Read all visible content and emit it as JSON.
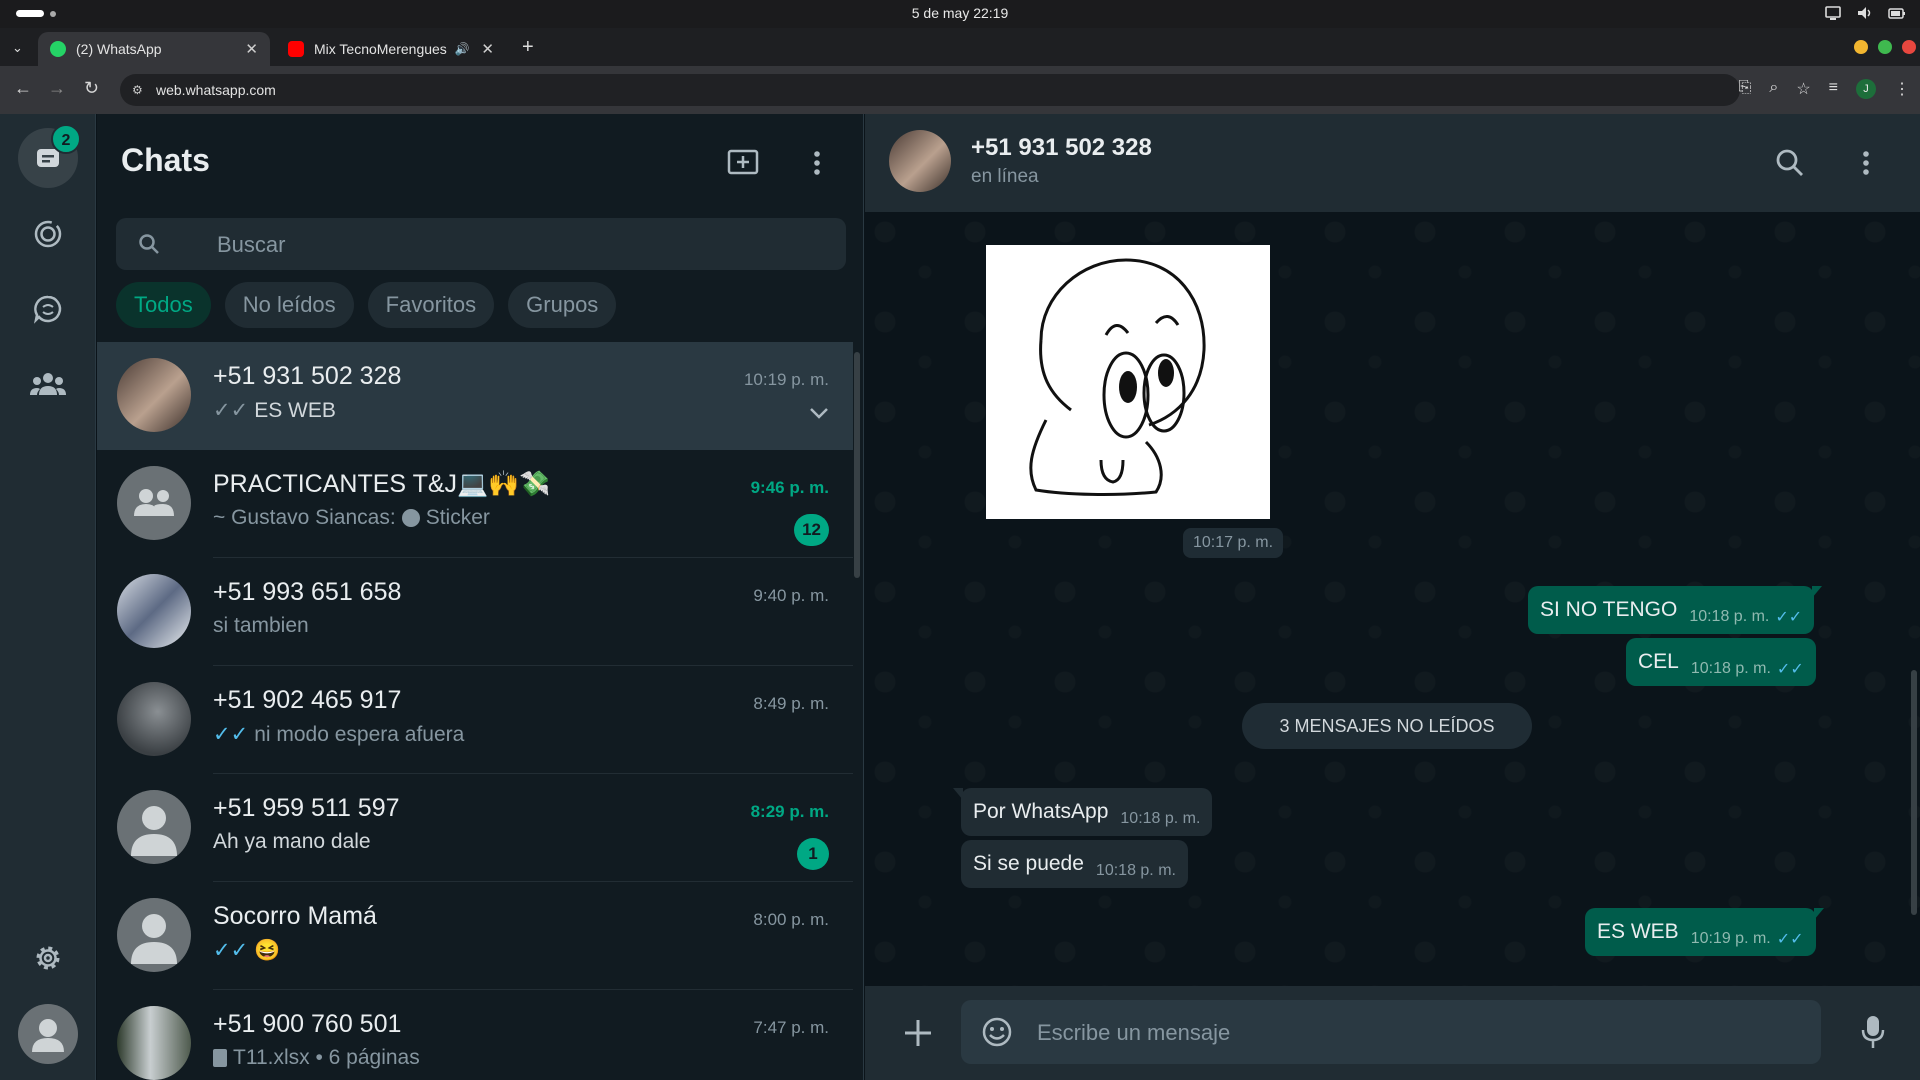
{
  "os": {
    "clock": "5 de may  22:19"
  },
  "browser": {
    "tabs": [
      {
        "label": "(2) WhatsApp",
        "active": true
      },
      {
        "label": "Mix TecnoMerengues",
        "active": false
      }
    ],
    "url": "web.whatsapp.com",
    "profile_initial": "J"
  },
  "rail": {
    "chats_badge": "2"
  },
  "list": {
    "title": "Chats",
    "search_placeholder": "Buscar",
    "filters": [
      "Todos",
      "No leídos",
      "Favoritos",
      "Grupos"
    ],
    "chats": [
      {
        "name": "+51 931 502 328",
        "preview": "ES WEB",
        "time": "10:19 p. m.",
        "ticks": "grey",
        "selected": true
      },
      {
        "name": "PRACTICANTES T&J💻🙌💸",
        "preview": "~ Gustavo Siancas: ",
        "preview_extra": "Sticker",
        "time": "9:46 p. m.",
        "unread": "12"
      },
      {
        "name": "+51 993 651 658",
        "preview": "si tambien",
        "time": "9:40 p. m."
      },
      {
        "name": "+51 902 465 917",
        "preview": "ni modo espera afuera",
        "time": "8:49 p. m.",
        "ticks": "blue"
      },
      {
        "name": "+51 959 511 597",
        "preview": "Ah ya mano dale",
        "time": "8:29 p. m.",
        "unread": "1"
      },
      {
        "name": "Socorro Mamá",
        "preview": "😆",
        "time": "8:00 p. m.",
        "ticks": "blue"
      },
      {
        "name": "+51 900 760 501",
        "preview": "T11.xlsx • 6 páginas",
        "time": "7:47 p. m."
      }
    ]
  },
  "conversation": {
    "name": "+51 931 502 328",
    "status": "en línea",
    "sticker_time": "10:17 p. m.",
    "messages": [
      {
        "text": "SI NO TENGO",
        "time": "10:18 p. m."
      },
      {
        "text": "CEL",
        "time": "10:18 p. m."
      },
      {
        "text": "Por WhatsApp",
        "time": "10:18 p. m."
      },
      {
        "text": "Si se puede",
        "time": "10:18 p. m."
      },
      {
        "text": "ES WEB",
        "time": "10:19 p. m."
      }
    ],
    "unread_separator": "3 MENSAJES NO LEÍDOS",
    "composer_placeholder": "Escribe un mensaje"
  },
  "colors": {
    "accent": "#00a884",
    "outgoing_bubble": "#005c4b",
    "incoming_bubble": "#202c33",
    "read_ticks": "#53bdeb"
  },
  "icons": [
    "search-icon",
    "menu-icon",
    "new-chat-icon",
    "status-icon",
    "channels-icon",
    "communities-icon",
    "settings-icon",
    "attach-icon",
    "emoji-icon",
    "mic-icon",
    "chevron-down-icon"
  ]
}
